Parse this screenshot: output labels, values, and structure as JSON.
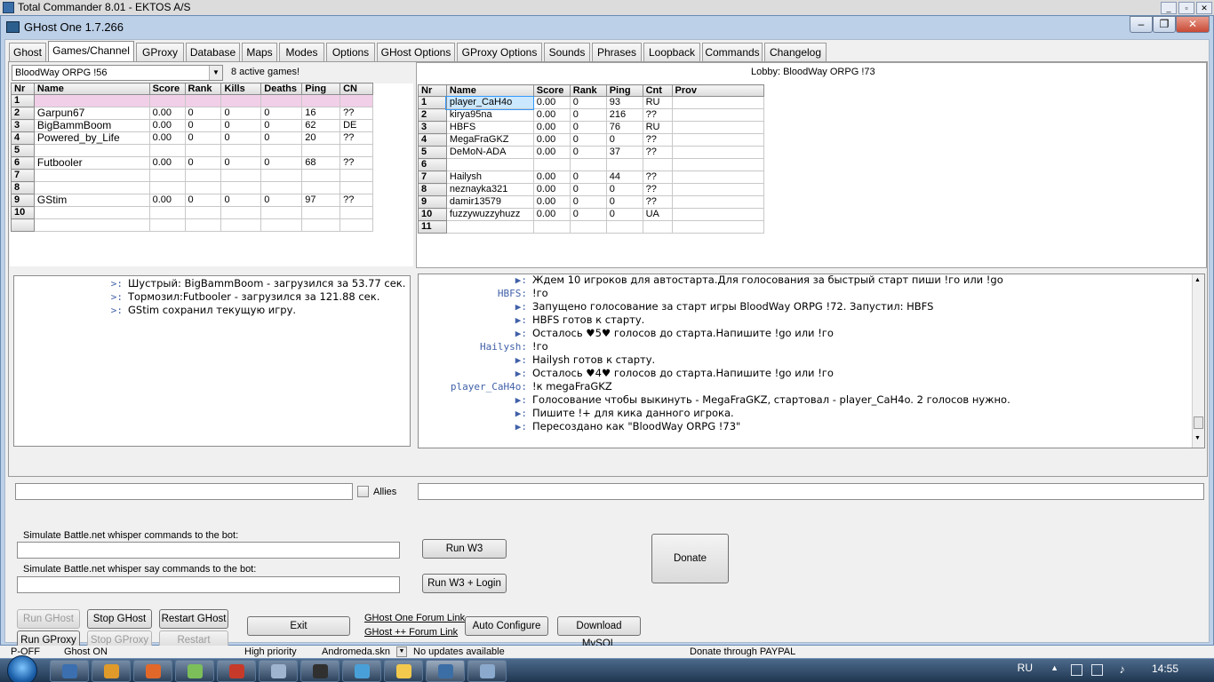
{
  "tc_title": "Total Commander 8.01 - EKTOS A/S",
  "window_title": "GHost One 1.7.266",
  "tabs": [
    "Ghost",
    "Games/Channel",
    "GProxy",
    "Database",
    "Maps",
    "Modes",
    "Options",
    "GHost Options",
    "GProxy Options",
    "Sounds",
    "Phrases",
    "Loopback",
    "Commands",
    "Changelog"
  ],
  "games": {
    "combo_value": "BloodWay ORPG !56",
    "active_games": "8 active games!",
    "columns": [
      "Nr",
      "Name",
      "Score",
      "Rank",
      "Kills",
      "Deaths",
      "Ping",
      "CN"
    ],
    "rows": [
      [
        "1",
        "",
        "",
        "",
        "",
        "",
        "",
        ""
      ],
      [
        "2",
        "Garpun67",
        "0.00",
        "0",
        "0",
        "0",
        "16",
        "??"
      ],
      [
        "3",
        "BigBammBoom",
        "0.00",
        "0",
        "0",
        "0",
        "62",
        "DE"
      ],
      [
        "4",
        "Powered_by_Life",
        "0.00",
        "0",
        "0",
        "0",
        "20",
        "??"
      ],
      [
        "5",
        "",
        "",
        "",
        "",
        "",
        "",
        ""
      ],
      [
        "6",
        "Futbooler",
        "0.00",
        "0",
        "0",
        "0",
        "68",
        "??"
      ],
      [
        "7",
        "",
        "",
        "",
        "",
        "",
        "",
        ""
      ],
      [
        "8",
        "",
        "",
        "",
        "",
        "",
        "",
        ""
      ],
      [
        "9",
        "GStim",
        "0.00",
        "0",
        "0",
        "0",
        "97",
        "??"
      ],
      [
        "10",
        "",
        "",
        "",
        "",
        "",
        "",
        ""
      ],
      [
        "",
        "",
        "",
        "",
        "",
        "",
        "",
        ""
      ]
    ]
  },
  "lobby": {
    "title": "Lobby: BloodWay ORPG !73",
    "columns": [
      "Nr",
      "Name",
      "Score",
      "Rank",
      "Ping",
      "Cnt",
      "Prov"
    ],
    "rows": [
      [
        "1",
        "player_CaH4o",
        "0.00",
        "0",
        "93",
        "RU",
        ""
      ],
      [
        "2",
        "kirya95na",
        "0.00",
        "0",
        "216",
        "??",
        ""
      ],
      [
        "3",
        "HBFS",
        "0.00",
        "0",
        "76",
        "RU",
        ""
      ],
      [
        "4",
        "MegaFraGKZ",
        "0.00",
        "0",
        "0",
        "??",
        ""
      ],
      [
        "5",
        "DeMoN-ADA",
        "0.00",
        "0",
        "37",
        "??",
        ""
      ],
      [
        "6",
        "",
        "",
        "",
        "",
        "",
        ""
      ],
      [
        "7",
        "Hailysh",
        "0.00",
        "0",
        "44",
        "??",
        ""
      ],
      [
        "8",
        "neznayka321",
        "0.00",
        "0",
        "0",
        "??",
        ""
      ],
      [
        "9",
        "damir13579",
        "0.00",
        "0",
        "0",
        "??",
        ""
      ],
      [
        "10",
        "fuzzywuzzyhuzz",
        "0.00",
        "0",
        "0",
        "UA",
        ""
      ],
      [
        "11",
        "",
        "",
        "",
        "",
        "",
        ""
      ]
    ]
  },
  "left_chat": [
    {
      "who": ">:",
      "msg": "Шустрый: BigBammBoom - загрузился за 53.77 сек."
    },
    {
      "who": ">:",
      "msg": "Тормозил:Futbooler - загрузился за 121.88 сек."
    },
    {
      "who": ">:",
      "msg": "GStim сохранил текущую игру."
    }
  ],
  "right_chat": [
    {
      "who": "▶:",
      "msg": "Ждем 10 игроков для автостарта.Для голосования за быстрый старт пиши !го или !go"
    },
    {
      "who": "HBFS:",
      "msg": "!го"
    },
    {
      "who": "▶:",
      "msg": "Запущено голосование за старт игры BloodWay ORPG !72. Запустил: HBFS"
    },
    {
      "who": "▶:",
      "msg": "HBFS готов к старту."
    },
    {
      "who": "▶:",
      "msg": "Осталось ♥5♥ голосов до старта.Напишите !go или !го"
    },
    {
      "who": "Hailysh:",
      "msg": "!го"
    },
    {
      "who": "▶:",
      "msg": "Hailysh готов к старту."
    },
    {
      "who": "▶:",
      "msg": "Осталось ♥4♥ голосов до старта.Напишите !go или !го"
    },
    {
      "who": "player_CaH4o:",
      "msg": "!к megaFraGKZ"
    },
    {
      "who": "▶:",
      "msg": "Голосование чтобы выкинуть - MegaFraGKZ, стартовал - player_CaH4o. 2 голосов нужно."
    },
    {
      "who": "▶:",
      "msg": "Пишите !+ для кика данного игрока."
    },
    {
      "who": "▶:",
      "msg": "Пересоздано  как \"BloodWay ORPG !73\""
    }
  ],
  "allies_label": "Allies",
  "whisper_label": "Simulate Battle.net whisper commands to the bot:",
  "say_label": "Simulate Battle.net whisper say commands to the bot:",
  "buttons": {
    "run_w3": "Run W3",
    "run_w3_login": "Run W3 + Login",
    "donate": "Donate",
    "run_ghost": "Run GHost",
    "stop_ghost": "Stop GHost",
    "restart_ghost": "Restart GHost",
    "run_gproxy": "Run GProxy",
    "stop_gproxy": "Stop GProxy",
    "restart_gproxy": "Restart GProxy",
    "exit": "Exit",
    "auto_configure": "Auto Configure",
    "download_mysql": "Download MySQL"
  },
  "links": {
    "ghost_one_forum": "GHost One Forum Link",
    "ghost_pp_forum": "GHost ++ Forum Link"
  },
  "status": {
    "s1": "P-OFF",
    "s2": "Ghost ON",
    "s3": "High priority",
    "skin": "Andromeda.skn",
    "updates": "No updates available",
    "paypal": "Donate through PAYPAL"
  },
  "tray": {
    "lang": "RU",
    "time": "14:55"
  },
  "taskbar_apps": [
    "floppy-icon",
    "flash-icon",
    "firefox-icon",
    "notepad-icon",
    "bomb-icon",
    "window-icon",
    "console-icon",
    "globe-icon",
    "paint-icon",
    "monitor-icon",
    "app-icon"
  ]
}
